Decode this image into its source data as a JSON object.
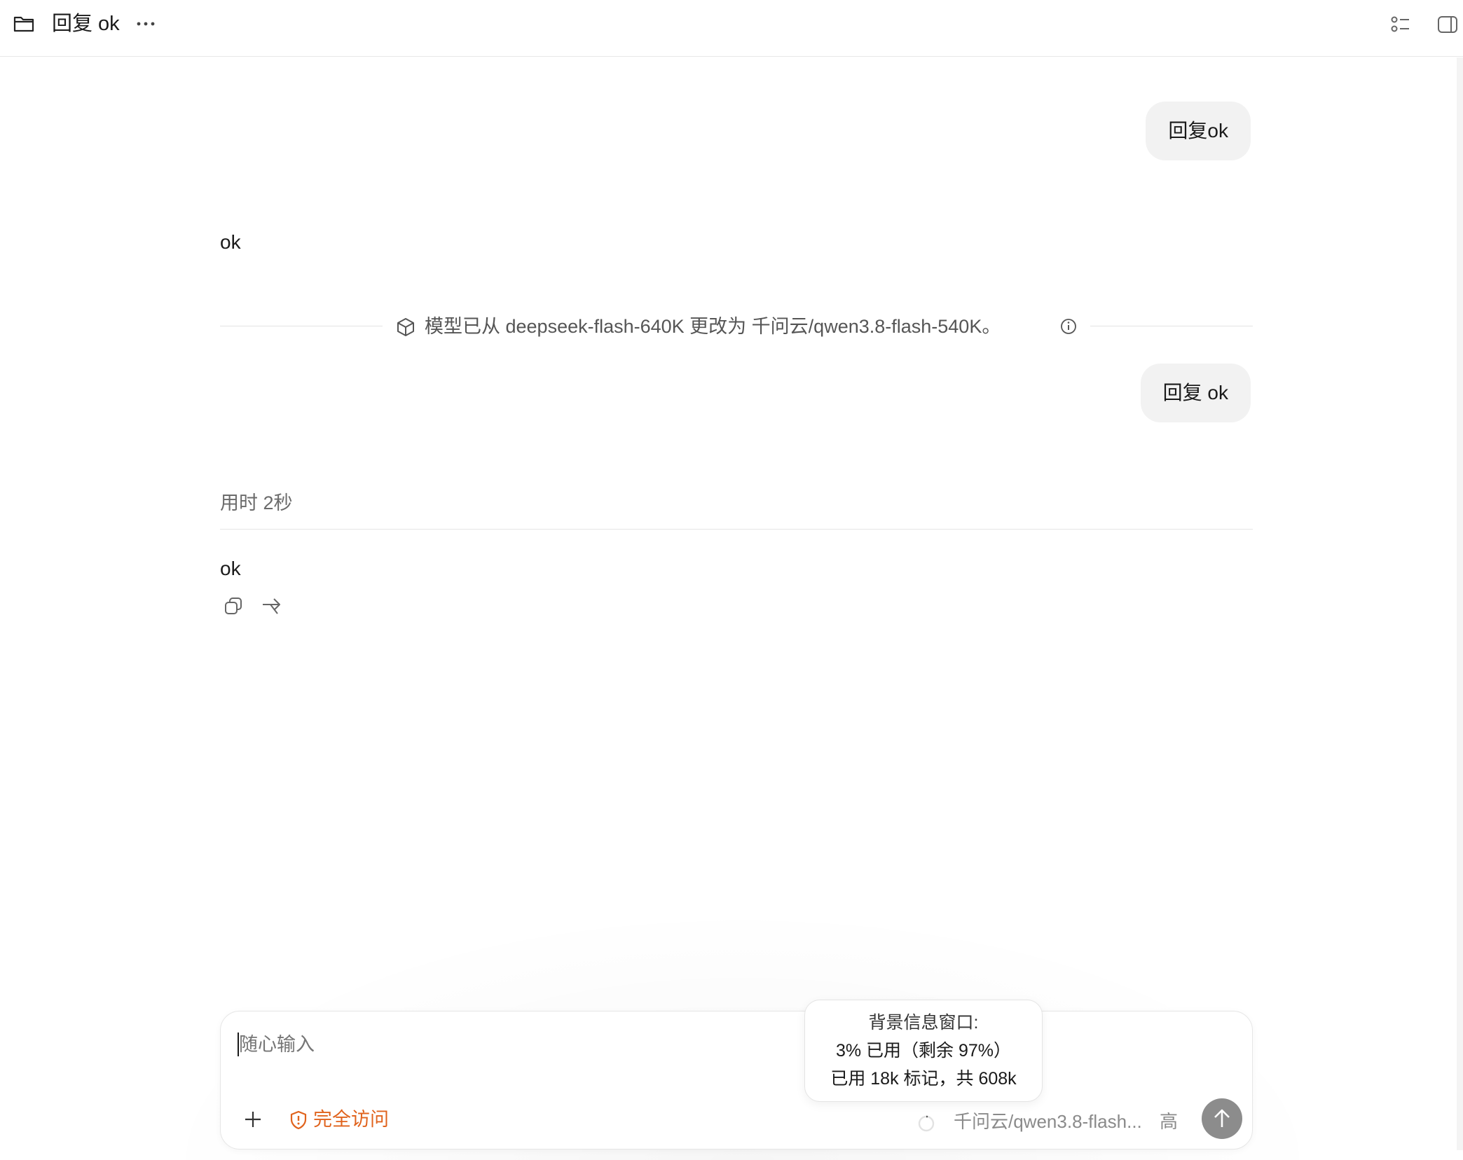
{
  "header": {
    "title": "回复 ok",
    "icons": [
      "folder-icon",
      "more-icon",
      "list-icon",
      "panel-icon"
    ]
  },
  "messages": {
    "user_1": "回复ok",
    "assistant_1": "ok",
    "model_change_notice": "模型已从 deepseek-flash-640K 更改为 千问云/qwen3.8-flash-540K。",
    "user_2": "回复 ok",
    "duration": "用时 2秒",
    "assistant_2": "ok"
  },
  "message_actions": [
    "copy-icon",
    "branch-icon"
  ],
  "composer": {
    "placeholder": "随心输入",
    "access_label": "完全访问",
    "model_label": "千问云/qwen3.8-flash...",
    "effort_label": "高"
  },
  "context_tooltip": {
    "title": "背景信息窗口:",
    "usage": "3% 已用（剩余 97%）",
    "tokens": "已用 18k 标记，共 608k"
  },
  "colors": {
    "accent_warning": "#e0631d",
    "bubble_bg": "#f2f2f2",
    "send_button": "#8c8c8c"
  }
}
